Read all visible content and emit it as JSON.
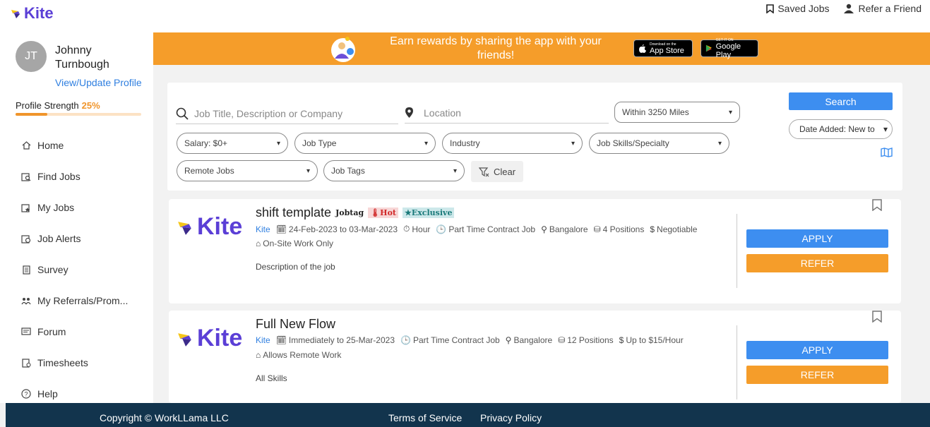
{
  "app": {
    "logo_text": "Kite"
  },
  "header": {
    "saved_jobs": "Saved Jobs",
    "refer_friend": "Refer a Friend"
  },
  "user": {
    "initials": "JT",
    "name": "Johnny Turnbough",
    "profile_link": "View/Update Profile",
    "strength_label": "Profile Strength",
    "strength_pct": "25%",
    "strength_value": 0.25
  },
  "sidebar": {
    "items": [
      {
        "label": "Home",
        "icon": "home-icon"
      },
      {
        "label": "Find Jobs",
        "icon": "find-jobs-icon"
      },
      {
        "label": "My Jobs",
        "icon": "my-jobs-icon"
      },
      {
        "label": "Job Alerts",
        "icon": "job-alerts-icon"
      },
      {
        "label": "Survey",
        "icon": "survey-icon"
      },
      {
        "label": "My Referrals/Prom...",
        "icon": "referrals-icon"
      },
      {
        "label": "Forum",
        "icon": "forum-icon"
      },
      {
        "label": "Timesheets",
        "icon": "timesheets-icon"
      },
      {
        "label": "Help",
        "icon": "help-icon"
      }
    ]
  },
  "banner": {
    "text": "Earn rewards by sharing the app with your friends!",
    "app_store_small": "Download on the",
    "app_store": "App Store",
    "google_play_small": "GET IT ON",
    "google_play": "Google Play",
    "color": "#f59d2a"
  },
  "search": {
    "keyword_placeholder": "Job Title, Description or Company",
    "location_placeholder": "Location",
    "radius": "Within 3250 Miles",
    "search_label": "Search",
    "sort": "Date Added: New to",
    "salary": "Salary: $0+",
    "job_type": "Job Type",
    "industry": "Industry",
    "skills": "Job Skills/Specialty",
    "remote": "Remote Jobs",
    "tags": "Job Tags",
    "clear": "Clear"
  },
  "jobs": [
    {
      "title": "shift template",
      "tag_jobtag": "Jobtag",
      "tag_hot": "Hot",
      "tag_exclusive": "Exclusive",
      "company": "Kite",
      "dates": "24-Feb-2023 to 03-Mar-2023",
      "duration": "Hour",
      "type": "Part Time Contract Job",
      "location": "Bangalore",
      "positions": "4 Positions",
      "pay": "Negotiable",
      "work_mode": "On-Site Work Only",
      "description": "Description of the job",
      "apply": "APPLY",
      "refer": "REFER"
    },
    {
      "title": "Full New Flow",
      "company": "Kite",
      "dates": "Immediately to 25-Mar-2023",
      "type": "Part Time Contract Job",
      "location": "Bangalore",
      "positions": "12 Positions",
      "pay": "Up to $15/Hour",
      "work_mode": "Allows Remote Work",
      "description": "All Skills",
      "apply": "APPLY",
      "refer": "REFER"
    }
  ],
  "footer": {
    "copyright": "Copyright © WorkLLama LLC",
    "terms": "Terms of Service",
    "privacy": "Privacy Policy"
  },
  "colors": {
    "brand": "#5b3fd6",
    "accent_orange": "#f59d2a",
    "primary_blue": "#3d8ef0",
    "footer": "#12344d"
  }
}
